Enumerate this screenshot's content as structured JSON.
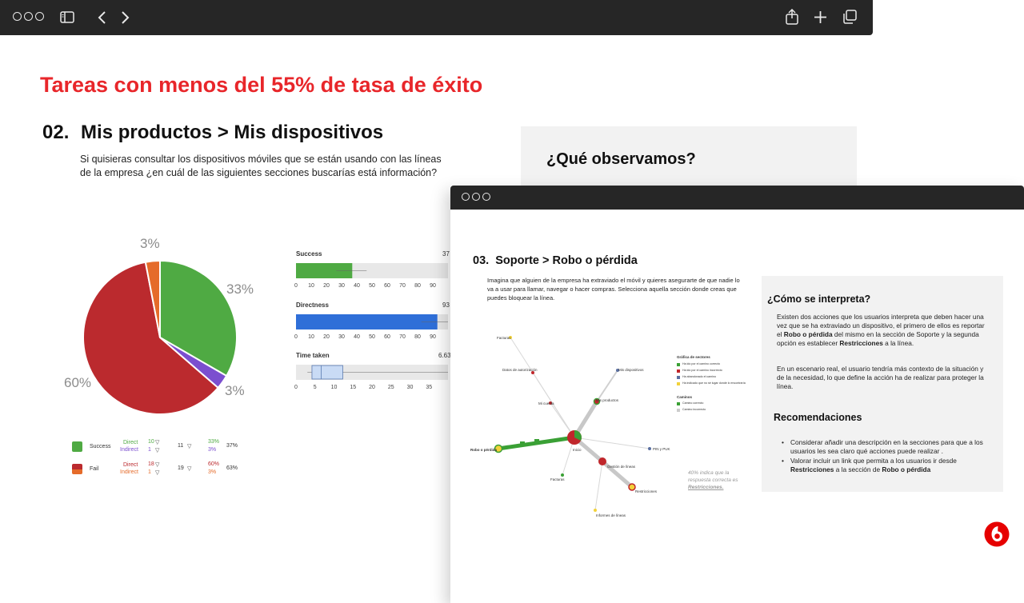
{
  "toolbar": {
    "icons": [
      "window-dots",
      "sidebar-icon",
      "chevron-left-icon",
      "chevron-right-icon",
      "share-icon",
      "plus-icon",
      "tabs-icon"
    ]
  },
  "slide1": {
    "heading": "Tareas con menos del 55% de tasa de éxito",
    "task_number": "02.",
    "task_title": "Mis productos > Mis dispositivos",
    "question": "Si quisieras consultar los dispositivos móviles que se están usando con las líneas de la empresa ¿en cuál de las siguientes secciones buscarías está información?",
    "panel_title": "¿Qué observamos?",
    "pie": {
      "slices": [
        {
          "label": "33%",
          "value": 33,
          "color": "#4faa43"
        },
        {
          "label": "3%",
          "value": 3,
          "color": "#7b4fcf"
        },
        {
          "label": "60%",
          "value": 60,
          "color": "#bb2a2e"
        },
        {
          "label": "3%",
          "value": 3,
          "color": "#e56b2a"
        }
      ]
    },
    "legend": [
      {
        "name": "Success",
        "color": "#4faa43",
        "direct_label": "Direct",
        "indirect_label": "Indirect",
        "direct": "10",
        "indirect": "1",
        "total": "11",
        "pct_direct": "33%",
        "pct_indirect": "3%",
        "pct_total": "37%"
      },
      {
        "name": "Fail",
        "color": "#bb2a2e",
        "color2": "#e56b2a",
        "direct_label": "Direct",
        "indirect_label": "Indirect",
        "direct": "18",
        "indirect": "1",
        "total": "19",
        "pct_direct": "60%",
        "pct_indirect": "3%",
        "pct_total": "63%"
      }
    ],
    "bars": [
      {
        "label": "Success",
        "value_text": "37",
        "value": 37,
        "color": "#4faa43",
        "ticks": [
          "0",
          "10",
          "20",
          "30",
          "40",
          "50",
          "60",
          "70",
          "80",
          "90"
        ]
      },
      {
        "label": "Directness",
        "value_text": "93",
        "value": 93,
        "color": "#2f6fd8",
        "ticks": [
          "0",
          "10",
          "20",
          "30",
          "40",
          "50",
          "60",
          "70",
          "80",
          "90"
        ]
      },
      {
        "label": "Time taken",
        "value_text": "6.63",
        "value": 6.63,
        "ticks": [
          "0",
          "5",
          "10",
          "15",
          "20",
          "25",
          "30",
          "35"
        ]
      }
    ]
  },
  "slide2": {
    "task_number": "03.",
    "task_title": "Soporte > Robo o pérdida",
    "question": "Imagina que alguien de la empresa ha extraviado el móvil y quieres asegurarte de que nadie lo va a usar para llamar, navegar o hacer compras. Selecciona aquella sección donde creas que puedes bloquear la línea.",
    "interpret_title": "¿Cómo se interpreta?",
    "interpret_p1_a": "Existen dos acciones que los usuarios interpreta que deben hacer una vez que se ha extraviado un dispositivo, el primero de ellos es reportar el ",
    "interpret_p1_b": "Robo o pérdida",
    "interpret_p1_c": " del mismo en la sección de Soporte y la segunda opción es establecer ",
    "interpret_p1_d": "Restricciones",
    "interpret_p1_e": " a la línea.",
    "interpret_p2": "En un escenario real, el usuario tendría más contexto de la situación y de la necesidad, lo que define la acción ha de realizar para proteger la línea.",
    "rec_title": "Recomendaciones",
    "rec1": "Considerar añadir una descripción en la secciones para que a los usuarios les sea claro qué acciones puede realizar .",
    "rec2_a": "Valorar incluir un link que permita a los usuarios ir desde ",
    "rec2_b": "Restricciones",
    "rec2_c": " a la sección de ",
    "rec2_d": "Robo o pérdida",
    "note_a": "40% indica que la respuesta correcta es ",
    "note_b": "Restricciones.",
    "legend_title": "Gráfica de sectores",
    "legend_items": [
      "Ha ido por el camino correcto",
      "Ha ido por el camino incorrecto",
      "Ha abandonado el camino",
      "Ha indicado que no sé lugar donde lo encontraría"
    ],
    "legend_colors": [
      "#3aa035",
      "#c0262b",
      "#5a6fa0",
      "#f2d23a"
    ],
    "paths_title": "Caminos",
    "paths_items": [
      "Camino correcto",
      "Camino incorrecto"
    ],
    "paths_colors": [
      "#3aa035",
      "#cccccc"
    ],
    "nodes": [
      "Facturas",
      "Datos de autorización",
      "Mi cuenta",
      "Mis productos",
      "Mis dispositivos",
      "Inicio",
      "Robo o pérdida",
      "Gestión de líneas",
      "PIN y PUK",
      "Restricciones",
      "Facturas",
      "Informes de líneas"
    ]
  },
  "brand": {
    "logo": "vodafone-logo",
    "color": "#e60000"
  }
}
